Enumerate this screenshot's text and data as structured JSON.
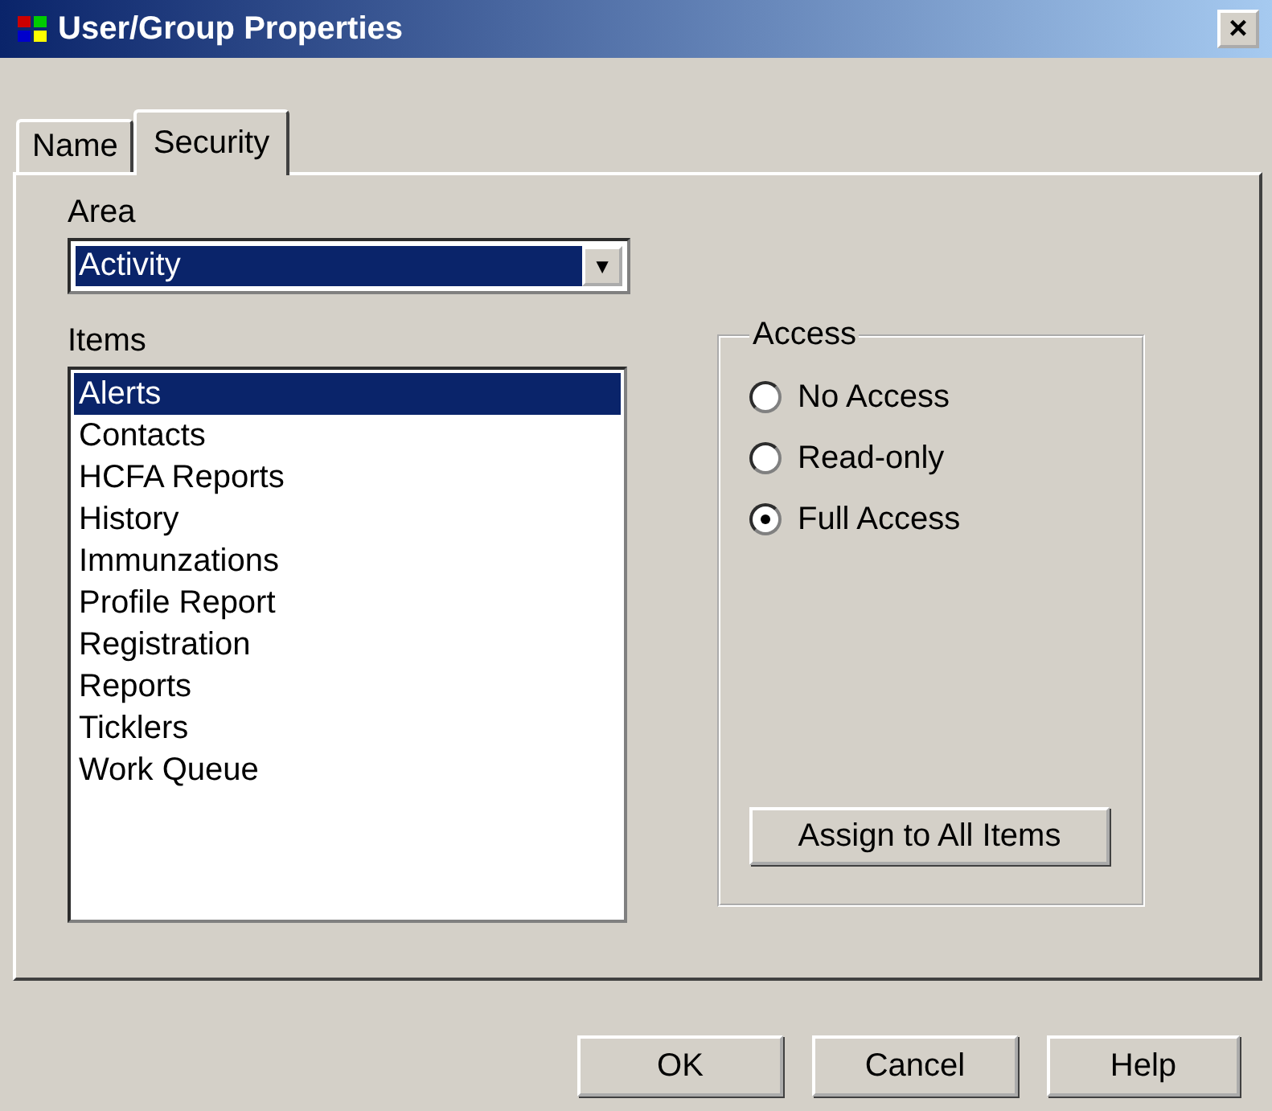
{
  "window": {
    "title": "User/Group Properties",
    "close": "×"
  },
  "tabs": [
    {
      "label": "Name",
      "selected": false
    },
    {
      "label": "Security",
      "selected": true
    }
  ],
  "area": {
    "label": "Area",
    "value": "Activity",
    "arrow": "▼"
  },
  "items": {
    "label": "Items",
    "list": [
      {
        "label": "Alerts",
        "selected": true
      },
      {
        "label": "Contacts",
        "selected": false
      },
      {
        "label": "HCFA Reports",
        "selected": false
      },
      {
        "label": "History",
        "selected": false
      },
      {
        "label": "Immunzations",
        "selected": false
      },
      {
        "label": "Profile Report",
        "selected": false
      },
      {
        "label": "Registration",
        "selected": false
      },
      {
        "label": "Reports",
        "selected": false
      },
      {
        "label": "Ticklers",
        "selected": false
      },
      {
        "label": "Work Queue",
        "selected": false
      }
    ]
  },
  "access": {
    "title": "Access",
    "options": [
      {
        "label": "No Access",
        "selected": false
      },
      {
        "label": "Read-only",
        "selected": false
      },
      {
        "label": "Full Access",
        "selected": true
      }
    ],
    "assign_button": "Assign to All Items"
  },
  "buttons": [
    "OK",
    "Cancel",
    "Help"
  ]
}
